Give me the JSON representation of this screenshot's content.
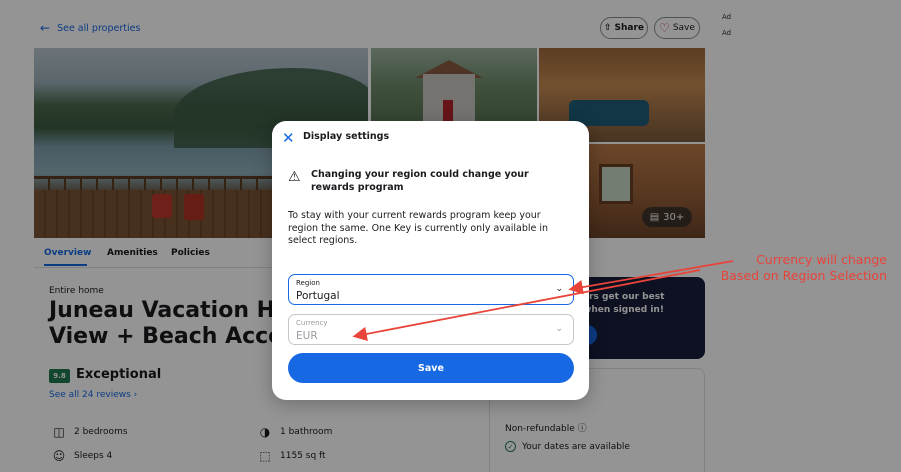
{
  "nav": {
    "back_label": "See all properties",
    "share_label": "Share",
    "save_label": "Save",
    "ad_labels": [
      "Ad",
      "Ad"
    ]
  },
  "gallery": {
    "photo_count": "30+"
  },
  "tabs": [
    {
      "label": "Overview"
    },
    {
      "label": "Amenities"
    },
    {
      "label": "Policies"
    }
  ],
  "property": {
    "type": "Entire home",
    "title_line1": "Juneau Vacation Hor",
    "title_line2": "View + Beach Access",
    "rating_score": "9.8",
    "rating_word": "Exceptional",
    "reviews_link": "See all 24 reviews",
    "amenities": [
      {
        "label": "2 bedrooms",
        "icon": "bed-icon"
      },
      {
        "label": "1 bathroom",
        "icon": "bath-icon"
      },
      {
        "label": "Sleeps 4",
        "icon": "people-icon"
      },
      {
        "label": "1155 sq ft",
        "icon": "area-icon"
      }
    ]
  },
  "promo": {
    "text_line1": "ers get our best",
    "text_line2": "when signed in!"
  },
  "rate": {
    "nonrefundable": "Non-refundable",
    "dates_available": "Your dates are available"
  },
  "modal": {
    "title": "Display settings",
    "warning": "Changing your region could change your rewards program",
    "info": "To stay with your current rewards program keep your region the same. One Key is currently only available in select regions.",
    "region": {
      "label": "Region",
      "value": "Portugal"
    },
    "currency": {
      "label": "Currency",
      "value": "EUR"
    },
    "save_label": "Save"
  },
  "annotation": {
    "line1": "Currency will change",
    "line2": "Based on Region Selection",
    "color": "#e8443a"
  },
  "colors": {
    "accent": "#1668e3",
    "rating_green": "#227950",
    "promo_navy": "#191e3b"
  }
}
